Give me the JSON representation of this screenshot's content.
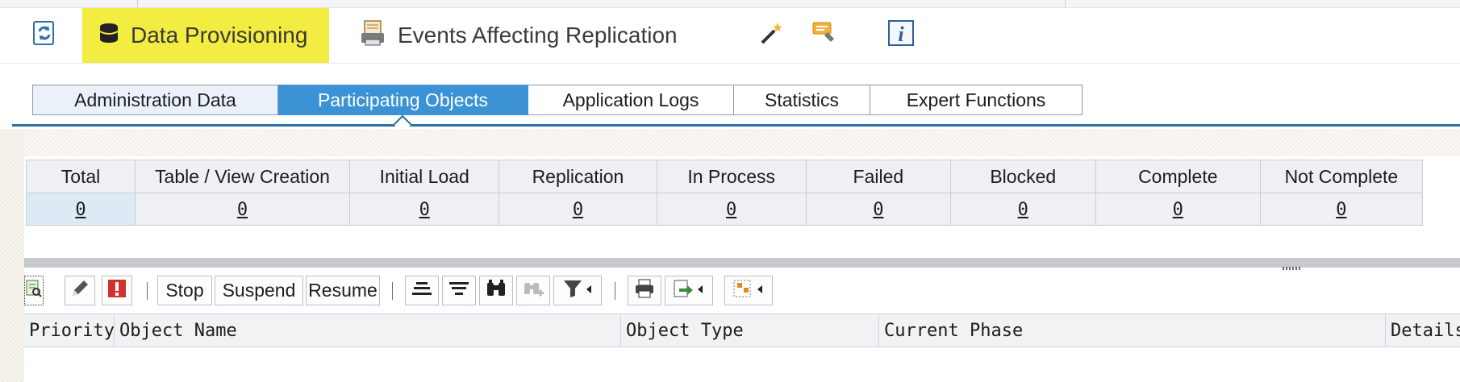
{
  "toolbar": {
    "refresh_icon": "refresh-icon",
    "data_provisioning": "Data Provisioning",
    "events_affecting_replication": "Events Affecting Replication",
    "magic_wand_icon": "magic-wand-icon",
    "highlighter_icon": "highlighter-icon",
    "info_icon": "info-icon",
    "highlight_color": "#f3ec41"
  },
  "tabs": [
    {
      "label": "Administration Data",
      "active": false
    },
    {
      "label": "Participating Objects",
      "active": true
    },
    {
      "label": "Application Logs",
      "active": false
    },
    {
      "label": "Statistics",
      "active": false
    },
    {
      "label": "Expert Functions",
      "active": false
    }
  ],
  "stats": {
    "headers": [
      "Total",
      "Table / View Creation",
      "Initial Load",
      "Replication",
      "In Process",
      "Failed",
      "Blocked",
      "Complete",
      "Not Complete"
    ],
    "values": [
      "0",
      "0",
      "0",
      "0",
      "0",
      "0",
      "0",
      "0",
      "0"
    ]
  },
  "alv_toolbar": {
    "stop": "Stop",
    "suspend": "Suspend",
    "resume": "Resume"
  },
  "columns": [
    "Priority",
    "Object Name",
    "Object Type",
    "Current Phase",
    "Details"
  ],
  "colors": {
    "active_tab": "#3b93d6",
    "tab_line": "#2f6fa0",
    "error_red": "#d0312d"
  }
}
